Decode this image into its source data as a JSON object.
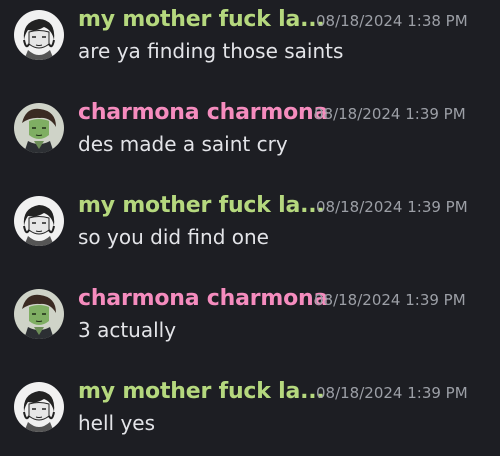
{
  "colors": {
    "background": "#1d1e23",
    "user_green": "#b5d87e",
    "user_pink": "#f58cbe",
    "timestamp": "#9c9fa6",
    "text": "#e3e4e8"
  },
  "messages": [
    {
      "username": "my mother fuck la...",
      "timestamp": "08/18/2024 1:38 PM",
      "content": "are ya finding those saints",
      "avatar": "sketch-portrait-avatar"
    },
    {
      "username": "charmona charmona",
      "timestamp": "08/18/2024 1:39 PM",
      "content": "des made a saint cry",
      "avatar": "green-character-avatar"
    },
    {
      "username": "my mother fuck la...",
      "timestamp": "08/18/2024 1:39 PM",
      "content": "so you did find one",
      "avatar": "sketch-portrait-avatar"
    },
    {
      "username": "charmona charmona",
      "timestamp": "08/18/2024 1:39 PM",
      "content": "3 actually",
      "avatar": "green-character-avatar"
    },
    {
      "username": "my mother fuck la...",
      "timestamp": "08/18/2024 1:39 PM",
      "content": "hell yes",
      "avatar": "sketch-portrait-avatar"
    }
  ]
}
